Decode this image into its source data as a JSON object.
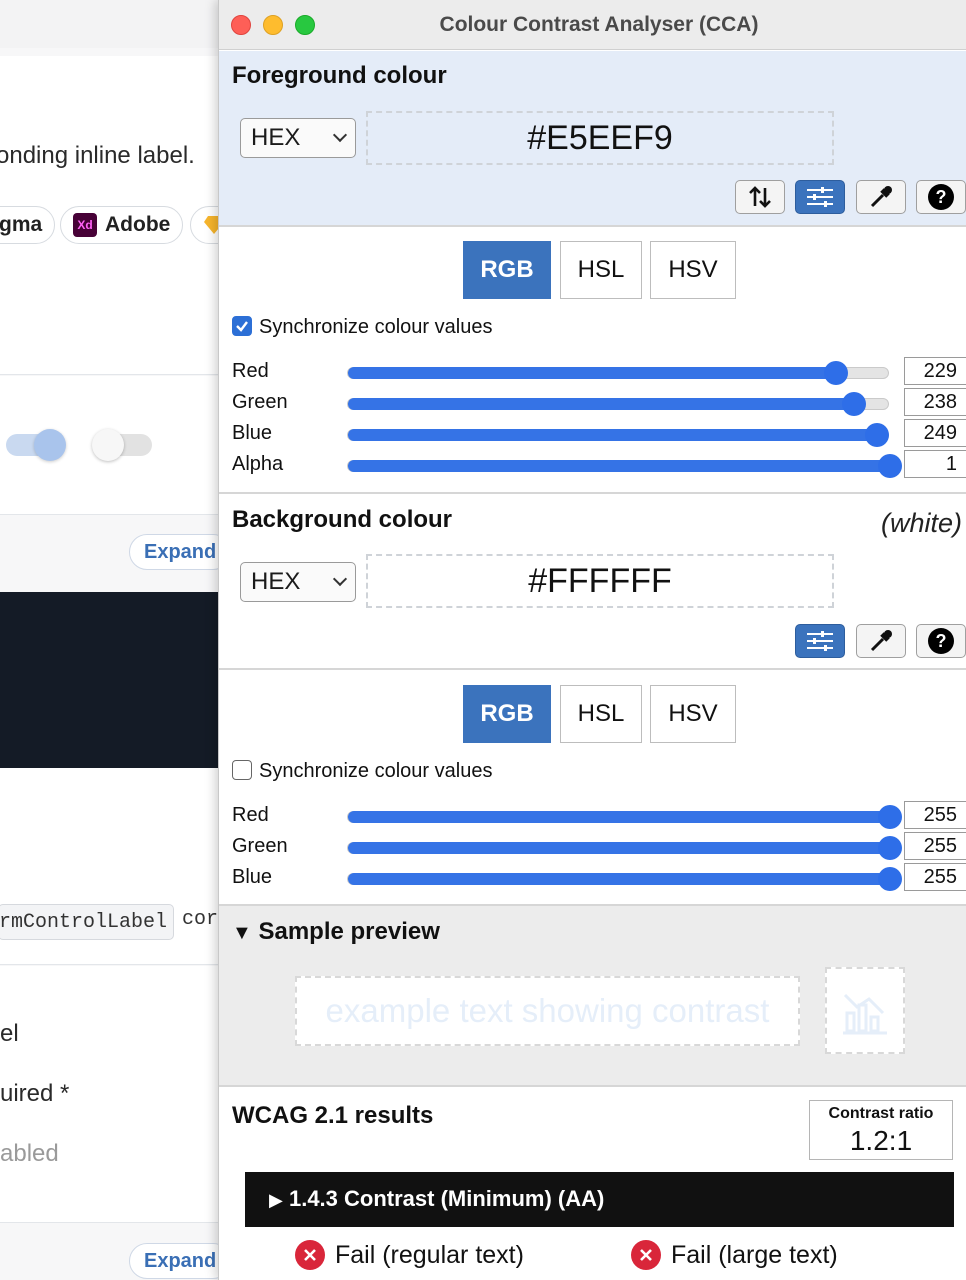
{
  "background_page": {
    "fragment_inline_label": "onding inline label.",
    "tool_figma": "gma",
    "tool_adobe": "Adobe",
    "xd_badge": "Xd",
    "expand_1": "Expand",
    "code_chip": "rmControlLabel",
    "code_after": "cor",
    "fragment_label": "el",
    "fragment_required": "uired *",
    "fragment_disabled": "abled",
    "expand_2": "Expand"
  },
  "window": {
    "title": "Colour Contrast Analyser (CCA)"
  },
  "foreground": {
    "heading": "Foreground colour",
    "format": "HEX",
    "hex": "#E5EEF9",
    "tabs": [
      "RGB",
      "HSL",
      "HSV"
    ],
    "active_tab": "RGB",
    "sync_label": "Synchronize colour values",
    "sync_checked": true,
    "sliders": [
      {
        "label": "Red",
        "value": "229",
        "fraction": 0.898
      },
      {
        "label": "Green",
        "value": "238",
        "fraction": 0.933
      },
      {
        "label": "Blue",
        "value": "249",
        "fraction": 0.976
      },
      {
        "label": "Alpha",
        "value": "1",
        "fraction": 1.0
      }
    ],
    "icons": [
      "swap-icon",
      "sliders-icon",
      "eyedropper-icon",
      "help-icon"
    ]
  },
  "background": {
    "heading": "Background colour",
    "name_note": "(white)",
    "format": "HEX",
    "hex": "#FFFFFF",
    "tabs": [
      "RGB",
      "HSL",
      "HSV"
    ],
    "active_tab": "RGB",
    "sync_label": "Synchronize colour values",
    "sync_checked": false,
    "sliders": [
      {
        "label": "Red",
        "value": "255",
        "fraction": 1.0
      },
      {
        "label": "Green",
        "value": "255",
        "fraction": 1.0
      },
      {
        "label": "Blue",
        "value": "255",
        "fraction": 1.0
      }
    ],
    "icons": [
      "sliders-icon",
      "eyedropper-icon",
      "help-icon"
    ]
  },
  "sample": {
    "heading": "Sample preview",
    "text": "example text showing contrast",
    "text_color": "#E5EEF9",
    "background_color": "#FFFFFF"
  },
  "results": {
    "heading": "WCAG 2.1 results",
    "ratio_label": "Contrast ratio",
    "ratio_value": "1.2:1",
    "criterion": "1.4.3 Contrast (Minimum) (AA)",
    "regular": "Fail (regular text)",
    "large": "Fail (large text)"
  },
  "colors": {
    "accent": "#3B73BD",
    "slider": "#3573E6",
    "fail": "#D9263A",
    "fg_section_bg": "#E4ECF8"
  }
}
